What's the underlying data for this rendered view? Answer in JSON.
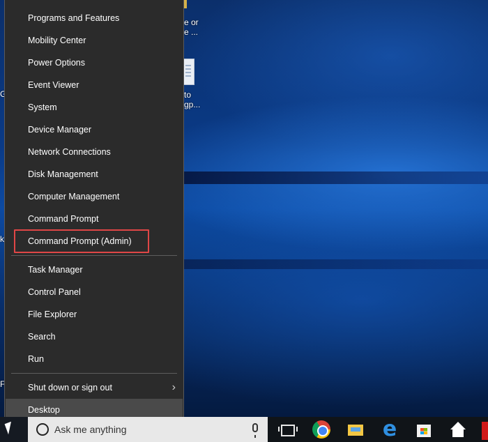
{
  "menu": {
    "group1": [
      {
        "label": "Programs and Features"
      },
      {
        "label": "Mobility Center"
      },
      {
        "label": "Power Options"
      },
      {
        "label": "Event Viewer"
      },
      {
        "label": "System"
      },
      {
        "label": "Device Manager"
      },
      {
        "label": "Network Connections"
      },
      {
        "label": "Disk Management"
      },
      {
        "label": "Computer Management"
      },
      {
        "label": "Command Prompt"
      },
      {
        "label": "Command Prompt (Admin)",
        "highlighted": true
      }
    ],
    "group2": [
      {
        "label": "Task Manager"
      },
      {
        "label": "Control Panel"
      },
      {
        "label": "File Explorer"
      },
      {
        "label": "Search"
      },
      {
        "label": "Run"
      }
    ],
    "group3": [
      {
        "label": "Shut down or sign out",
        "has_submenu": true,
        "submenu_glyph": "›"
      },
      {
        "label": "Desktop",
        "selected": true
      }
    ]
  },
  "desktop_icons": {
    "icon1_line1": "e or",
    "icon1_line2": "e ...",
    "icon2_line1": "to",
    "icon2_line2": "gp...",
    "left_edge_1": "G",
    "left_edge_2": "k",
    "left_edge_3": "F"
  },
  "taskbar": {
    "search_placeholder": "Ask me anything",
    "edge_glyph": "e",
    "apps": [
      "task-view-icon",
      "chrome-icon",
      "file-explorer-icon",
      "edge-icon",
      "store-icon",
      "home-icon"
    ]
  },
  "colors": {
    "menu_bg": "#2b2b2b",
    "highlight_border": "#e04646",
    "taskbar_bg": "#101418",
    "search_bg": "#e8e8e8"
  }
}
